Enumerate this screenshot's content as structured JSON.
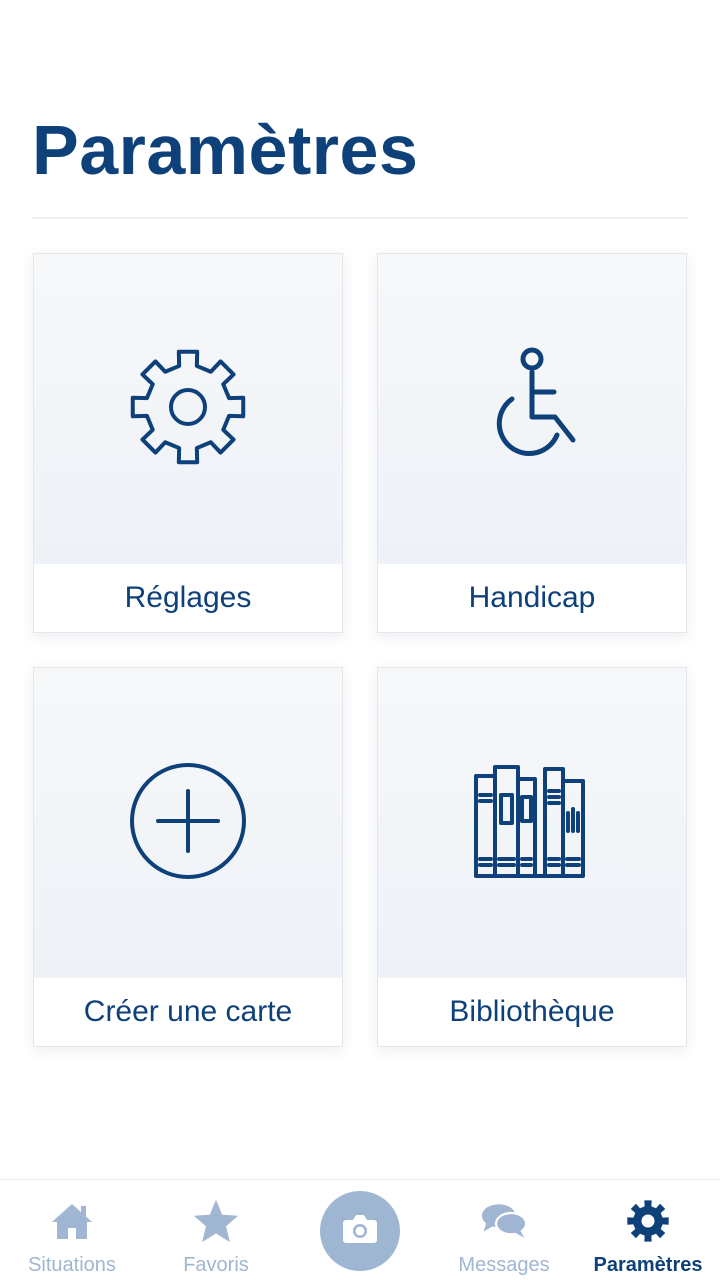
{
  "header": {
    "title": "Paramètres"
  },
  "cards": [
    {
      "label": "Réglages",
      "icon": "gear-icon"
    },
    {
      "label": "Handicap",
      "icon": "wheelchair-icon"
    },
    {
      "label": "Créer une carte",
      "icon": "plus-circle-icon"
    },
    {
      "label": "Bibliothèque",
      "icon": "books-icon"
    }
  ],
  "bottom_nav": {
    "items": [
      {
        "label": "Situations",
        "icon": "home-icon",
        "active": false
      },
      {
        "label": "Favoris",
        "icon": "star-icon",
        "active": false
      },
      {
        "label": "",
        "icon": "camera-icon",
        "active": false
      },
      {
        "label": "Messages",
        "icon": "chat-bubbles-icon",
        "active": false
      },
      {
        "label": "Paramètres",
        "icon": "gear-icon",
        "active": true
      }
    ]
  },
  "colors": {
    "primary": "#0e4079",
    "inactive_nav": "#a0b6d2",
    "camera_button": "#9fb6d3",
    "card_background": "#f3f5f9"
  }
}
